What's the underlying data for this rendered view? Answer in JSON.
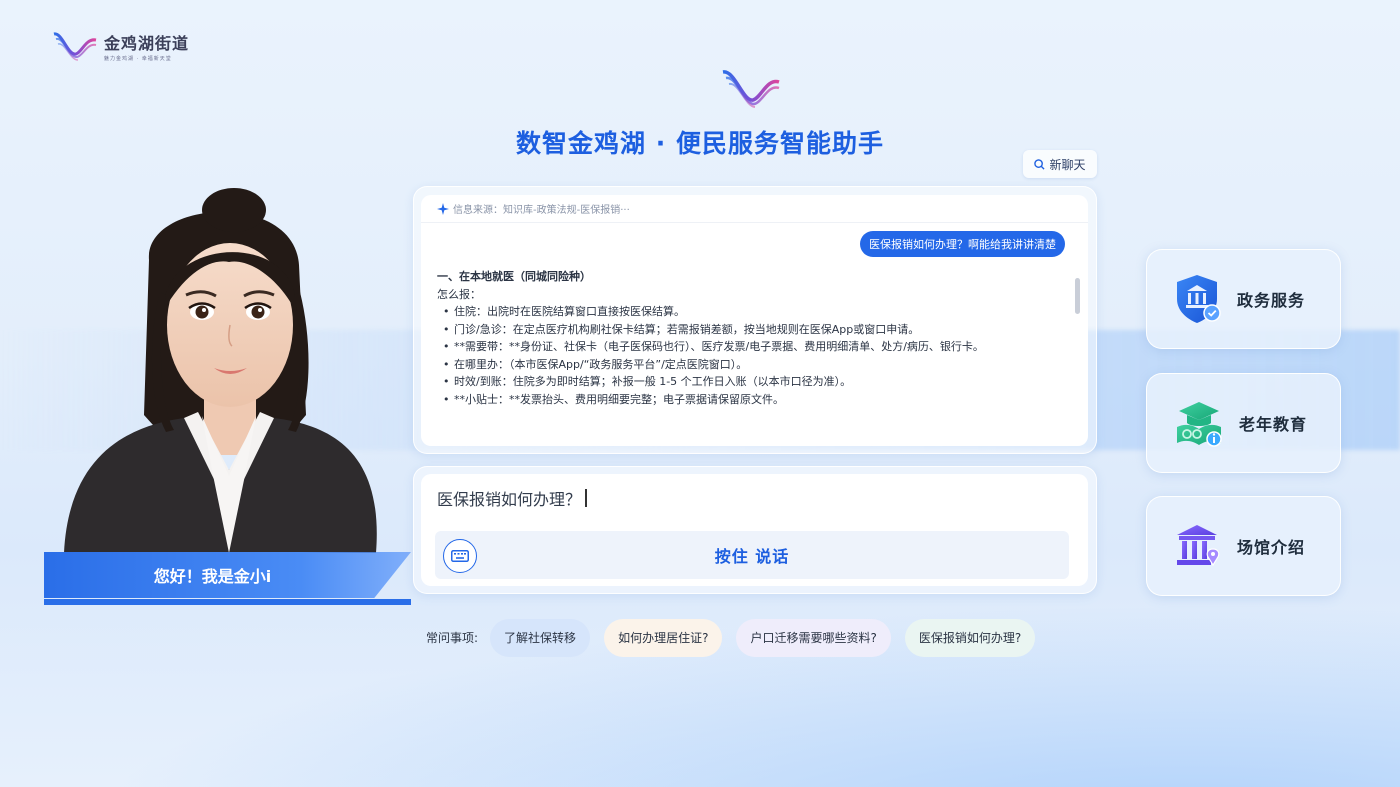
{
  "brand": {
    "name": "金鸡湖街道",
    "slogan": "魅力金鸡湖 · 幸福新天堂"
  },
  "header": {
    "title": "数智金鸡湖 · 便民服务智能助手",
    "new_chat_label": "新聊天"
  },
  "avatar": {
    "greeting": "您好！我是金小i"
  },
  "chat": {
    "source": "信息来源：知识库-政策法规-医保报销···",
    "user_message": "医保报销如何办理？啊能给我讲讲清楚",
    "answer": {
      "heading": "一、在本地就医（同城同险种）",
      "intro": "怎么报：",
      "items": [
        "住院：出院时在医院结算窗口直接按医保结算。",
        "门诊/急诊：在定点医疗机构刷社保卡结算；若需报销差额，按当地规则在医保App或窗口申请。",
        "**需要带：**身份证、社保卡（电子医保码也行）、医疗发票/电子票据、费用明细清单、处方/病历、银行卡。",
        "在哪里办：（本市医保App/“政务服务平台”/定点医院窗口）。",
        "时效/到账：住院多为即时结算；补报一般 1-5 个工作日入账（以本市口径为准）。",
        "**小贴士：**发票抬头、费用明细要完整；电子票据请保留原文件。"
      ]
    }
  },
  "input": {
    "value": "医保报销如何办理？",
    "hold_to_talk": "按住 说话"
  },
  "faq": {
    "label": "常问事项:",
    "items": [
      "了解社保转移",
      "如何办理居住证?",
      "户口迁移需要哪些资料?",
      "医保报销如何办理?"
    ]
  },
  "side_menu": [
    {
      "label": "政务服务",
      "icon": "shield-bank-icon"
    },
    {
      "label": "老年教育",
      "icon": "graduation-book-icon"
    },
    {
      "label": "场馆介绍",
      "icon": "museum-location-icon"
    }
  ],
  "colors": {
    "primary": "#1d5fe0",
    "bubble": "#2468e8",
    "banner": "#2a6ee8"
  }
}
